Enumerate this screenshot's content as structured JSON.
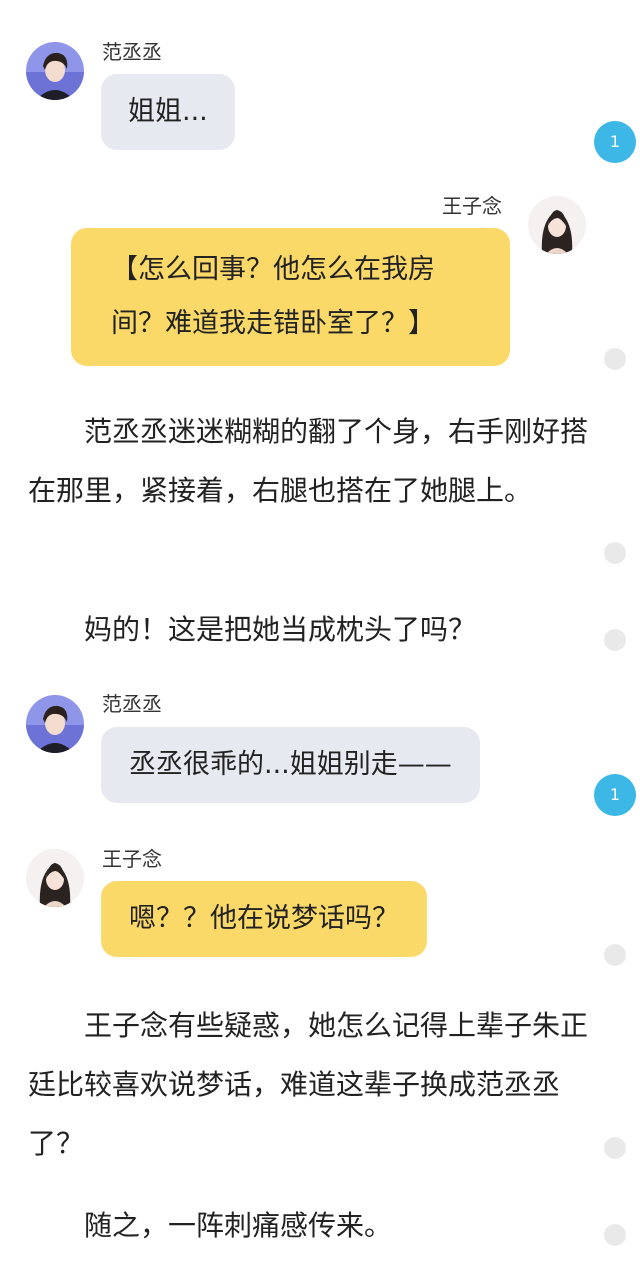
{
  "characters": {
    "fan": {
      "name": "范丞丞"
    },
    "wang": {
      "name": "王子念"
    }
  },
  "messages": [
    {
      "speaker": "范丞丞",
      "text": "姐姐..."
    },
    {
      "speaker": "王子念",
      "text": "【怎么回事？他怎么在我房间？难道我走错卧室了？】"
    },
    {
      "speaker": "范丞丞",
      "text": "丞丞很乖的...姐姐别走——"
    },
    {
      "speaker": "王子念",
      "text": "嗯？？他在说梦话吗？"
    }
  ],
  "narration": [
    "范丞丞迷迷糊糊的翻了个身，右手刚好搭在那里，紧接着，右腿也搭在了她腿上。",
    "妈的！这是把她当成枕头了吗？",
    "王子念有些疑惑，她怎么记得上辈子朱正廷比较喜欢说梦话，难道这辈子换成范丞丞了？",
    "随之，一阵刺痛感传来。"
  ],
  "comment_badges": [
    "1",
    "1"
  ],
  "colors": {
    "grey_bubble": "#e6e9ef",
    "yellow_bubble": "#fbd968",
    "badge": "#3cb7e6",
    "dot": "#e9e9e9"
  }
}
